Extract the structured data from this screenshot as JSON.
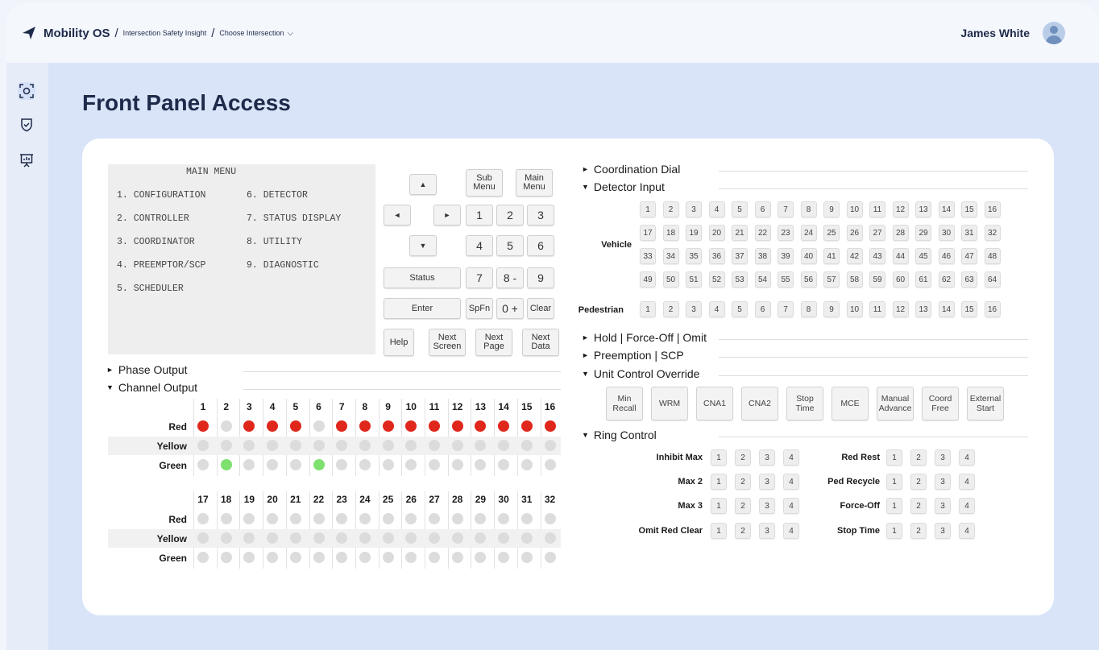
{
  "header": {
    "brand": "Mobility OS",
    "separator": "/",
    "crumb_1": "Intersection Safety Insight",
    "crumb_2": "Choose Intersection",
    "user_name": "James White"
  },
  "sidebar": {
    "items": [
      {
        "icon": "scan-icon"
      },
      {
        "icon": "shield-check-icon"
      },
      {
        "icon": "presentation-chart-icon"
      }
    ]
  },
  "page": {
    "title": "Front Panel Access"
  },
  "lcd": {
    "title": "MAIN MENU",
    "items": [
      "1. CONFIGURATION",
      "2. CONTROLLER",
      "3. COORDINATOR",
      "4. PREEMPTOR/SCP",
      "5. SCHEDULER",
      "6. DETECTOR",
      "7. STATUS DISPLAY",
      "8. UTILITY",
      "9. DIAGNOSTIC"
    ]
  },
  "keypad": {
    "up": "▲",
    "left": "◄",
    "right": "►",
    "down": "▼",
    "sub_menu": "Sub Menu",
    "main_menu": "Main Menu",
    "status": "Status",
    "enter": "Enter",
    "spfn": "SpFn",
    "clear": "Clear",
    "help": "Help",
    "next_screen": "Next Screen",
    "next_page": "Next Page",
    "next_data": "Next Data",
    "digits": [
      "1",
      "2",
      "3",
      "4",
      "5",
      "6",
      "7",
      "8 -",
      "9",
      "0 +"
    ]
  },
  "sections": {
    "phase_output": "Phase Output",
    "channel_output": "Channel Output",
    "coordination_dial": "Coordination Dial",
    "detector_input": "Detector Input",
    "hold": "Hold | Force-Off | Omit",
    "preemption": "Preemption | SCP",
    "unit_control": "Unit Control Override",
    "ring_control": "Ring Control"
  },
  "channel_output": {
    "row_labels": [
      "Red",
      "Yellow",
      "Green"
    ],
    "channels": [
      "1",
      "2",
      "3",
      "4",
      "5",
      "6",
      "7",
      "8",
      "9",
      "10",
      "11",
      "12",
      "13",
      "14",
      "15",
      "16",
      "17",
      "18",
      "19",
      "20",
      "21",
      "22",
      "23",
      "24",
      "25",
      "26",
      "27",
      "28",
      "29",
      "30",
      "31",
      "32"
    ],
    "red": [
      1,
      0,
      1,
      1,
      1,
      0,
      1,
      1,
      1,
      1,
      1,
      1,
      1,
      1,
      1,
      1,
      0,
      0,
      0,
      0,
      0,
      0,
      0,
      0,
      0,
      0,
      0,
      0,
      0,
      0,
      0,
      0
    ],
    "yellow": [
      0,
      0,
      0,
      0,
      0,
      0,
      0,
      0,
      0,
      0,
      0,
      0,
      0,
      0,
      0,
      0,
      0,
      0,
      0,
      0,
      0,
      0,
      0,
      0,
      0,
      0,
      0,
      0,
      0,
      0,
      0,
      0
    ],
    "green": [
      0,
      1,
      0,
      0,
      0,
      1,
      0,
      0,
      0,
      0,
      0,
      0,
      0,
      0,
      0,
      0,
      0,
      0,
      0,
      0,
      0,
      0,
      0,
      0,
      0,
      0,
      0,
      0,
      0,
      0,
      0,
      0
    ]
  },
  "detector_input": {
    "vehicle_label": "Vehicle",
    "pedestrian_label": "Pedestrian",
    "vehicle": [
      "1",
      "2",
      "3",
      "4",
      "5",
      "6",
      "7",
      "8",
      "9",
      "10",
      "11",
      "12",
      "13",
      "14",
      "15",
      "16",
      "17",
      "18",
      "19",
      "20",
      "21",
      "22",
      "23",
      "24",
      "25",
      "26",
      "27",
      "28",
      "29",
      "30",
      "31",
      "32",
      "33",
      "34",
      "35",
      "36",
      "37",
      "38",
      "39",
      "40",
      "41",
      "42",
      "43",
      "44",
      "45",
      "46",
      "47",
      "48",
      "49",
      "50",
      "51",
      "52",
      "53",
      "54",
      "55",
      "56",
      "57",
      "58",
      "59",
      "60",
      "61",
      "62",
      "63",
      "64"
    ],
    "pedestrian": [
      "1",
      "2",
      "3",
      "4",
      "5",
      "6",
      "7",
      "8",
      "9",
      "10",
      "11",
      "12",
      "13",
      "14",
      "15",
      "16"
    ]
  },
  "unit_control": {
    "buttons": [
      "Min Recall",
      "WRM",
      "CNA1",
      "CNA2",
      "Stop Time",
      "MCE",
      "Manual Advance",
      "Coord Free",
      "External Start"
    ]
  },
  "ring_control": {
    "left_labels": [
      "Inhibit Max",
      "Max 2",
      "Max 3",
      "Omit Red Clear"
    ],
    "right_labels": [
      "Red Rest",
      "Ped Recycle",
      "Force-Off",
      "Stop Time"
    ],
    "rings": [
      "1",
      "2",
      "3",
      "4"
    ]
  },
  "colors": {
    "background": "#d9e4f9",
    "card": "#ffffff",
    "red_on": "#e0271c",
    "green_on": "#7ee06f",
    "off": "#dcdcdc",
    "title": "#1e2a4a"
  }
}
